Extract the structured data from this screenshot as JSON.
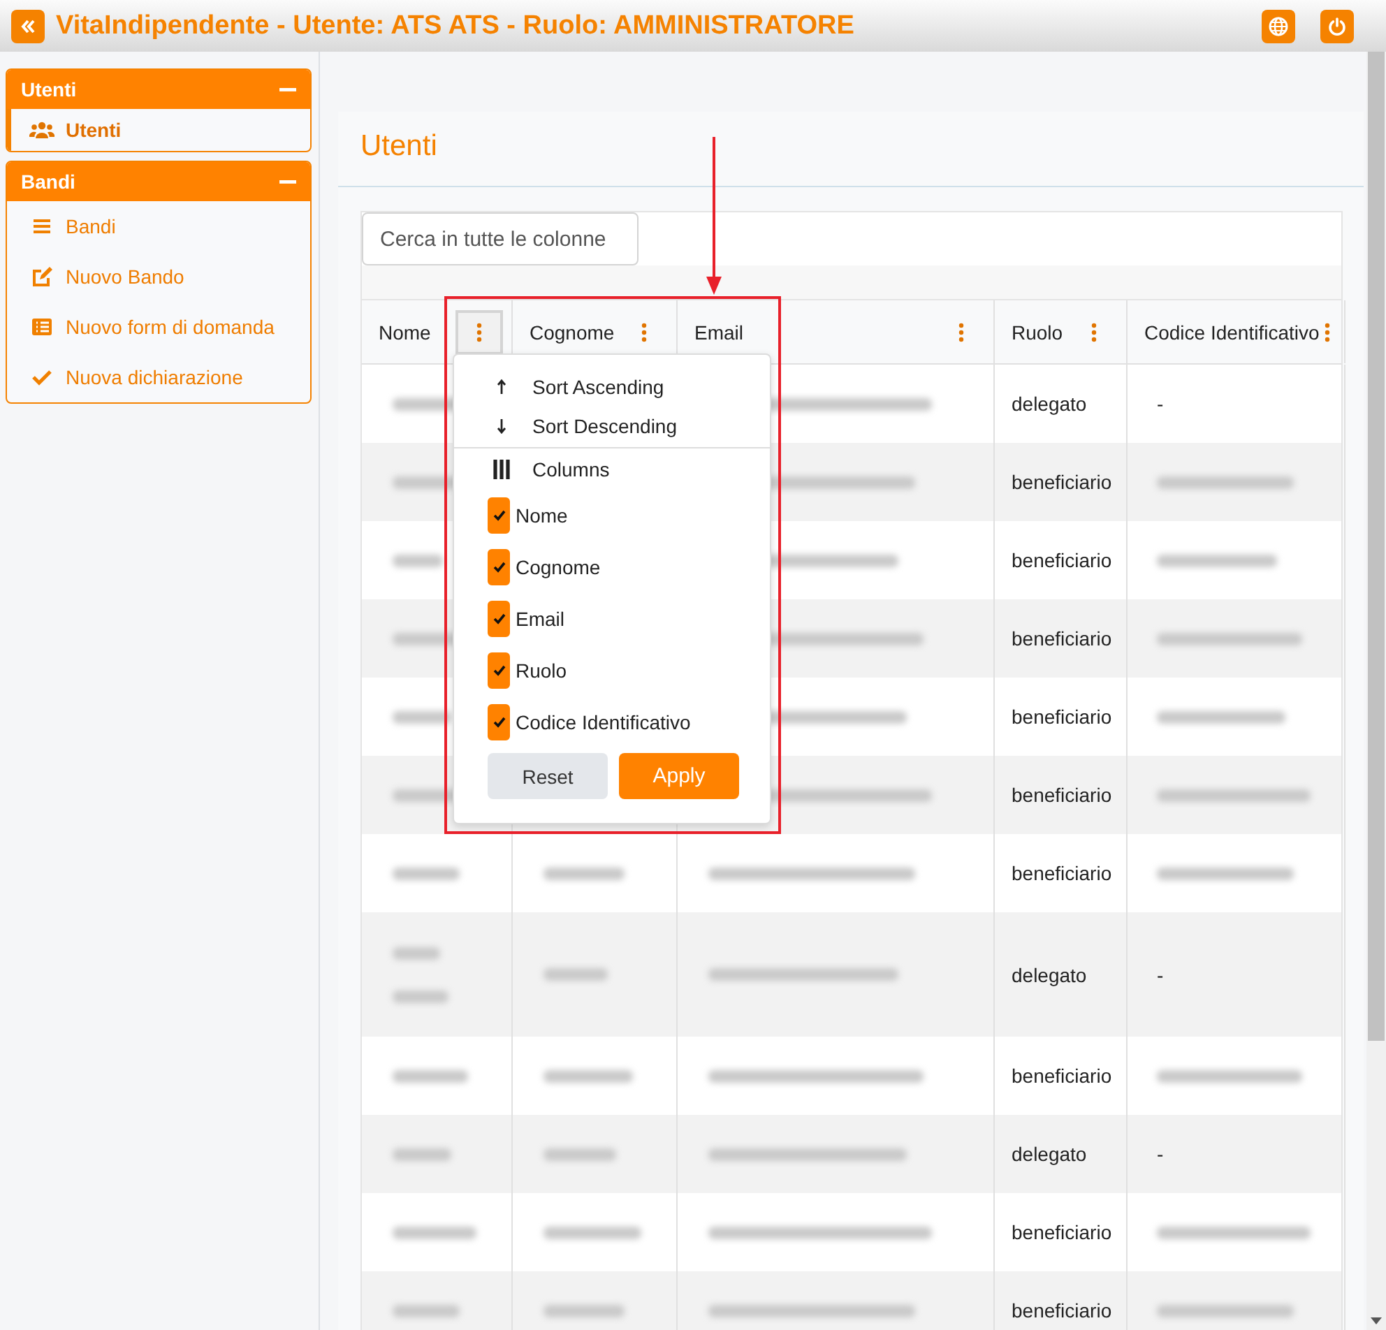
{
  "header": {
    "title": "VitaIndipendente - Utente: ATS ATS - Ruolo: AMMINISTRATORE"
  },
  "sidebar": {
    "groups": [
      {
        "title": "Utenti",
        "expanded": true,
        "items": [
          {
            "label": "Utenti",
            "kind": "users",
            "selected": true
          }
        ]
      },
      {
        "title": "Bandi",
        "expanded": true,
        "items": [
          {
            "label": "Bandi",
            "kind": "list",
            "selected": false
          },
          {
            "label": "Nuovo Bando",
            "kind": "edit",
            "selected": false
          },
          {
            "label": "Nuovo form di domanda",
            "kind": "form",
            "selected": false
          },
          {
            "label": "Nuova dichiarazione",
            "kind": "check",
            "selected": false
          }
        ]
      }
    ]
  },
  "page": {
    "title": "Utenti"
  },
  "search": {
    "placeholder": "Cerca in tutte le colonne"
  },
  "table": {
    "columns": [
      {
        "label": "Nome",
        "menu_open": true
      },
      {
        "label": "Cognome",
        "menu_open": false
      },
      {
        "label": "Email",
        "menu_open": false
      },
      {
        "label": "Ruolo",
        "menu_open": false
      },
      {
        "label": "Codice Identificativo",
        "menu_open": false
      }
    ],
    "rows": [
      {
        "cells": [
          {
            "kind": "blurred"
          },
          null,
          {
            "kind": "blurred"
          },
          {
            "kind": "text",
            "text": "delegato"
          },
          {
            "kind": "text",
            "text": "-"
          }
        ]
      },
      {
        "cells": [
          {
            "kind": "blurred"
          },
          null,
          {
            "kind": "blurred"
          },
          {
            "kind": "text",
            "text": "beneficiario"
          },
          {
            "kind": "blurred"
          }
        ]
      },
      {
        "cells": [
          {
            "kind": "blurred"
          },
          null,
          {
            "kind": "blurred"
          },
          {
            "kind": "text",
            "text": "beneficiario"
          },
          {
            "kind": "blurred"
          }
        ]
      },
      {
        "cells": [
          {
            "kind": "blurred"
          },
          null,
          {
            "kind": "blurred"
          },
          {
            "kind": "text",
            "text": "beneficiario"
          },
          {
            "kind": "blurred"
          }
        ]
      },
      {
        "cells": [
          {
            "kind": "blurred"
          },
          null,
          {
            "kind": "blurred"
          },
          {
            "kind": "text",
            "text": "beneficiario"
          },
          {
            "kind": "blurred"
          }
        ]
      },
      {
        "cells": [
          {
            "kind": "blurred"
          },
          null,
          {
            "kind": "blurred"
          },
          {
            "kind": "text",
            "text": "beneficiario"
          },
          {
            "kind": "blurred"
          }
        ]
      },
      {
        "cells": [
          {
            "kind": "blurred"
          },
          {
            "kind": "blurred"
          },
          {
            "kind": "blurred"
          },
          {
            "kind": "text",
            "text": "beneficiario"
          },
          {
            "kind": "blurred"
          }
        ]
      },
      {
        "cells": [
          {
            "kind": "blurred_tall"
          },
          {
            "kind": "blurred"
          },
          {
            "kind": "blurred"
          },
          {
            "kind": "text",
            "text": "delegato"
          },
          {
            "kind": "text",
            "text": "-"
          }
        ]
      },
      {
        "cells": [
          {
            "kind": "blurred"
          },
          {
            "kind": "blurred"
          },
          {
            "kind": "blurred"
          },
          {
            "kind": "text",
            "text": "beneficiario"
          },
          {
            "kind": "blurred"
          }
        ]
      },
      {
        "cells": [
          {
            "kind": "blurred"
          },
          {
            "kind": "blurred"
          },
          {
            "kind": "blurred"
          },
          {
            "kind": "text",
            "text": "delegato"
          },
          {
            "kind": "text",
            "text": "-"
          }
        ]
      },
      {
        "cells": [
          {
            "kind": "blurred"
          },
          {
            "kind": "blurred"
          },
          {
            "kind": "blurred"
          },
          {
            "kind": "text",
            "text": "beneficiario"
          },
          {
            "kind": "blurred"
          }
        ]
      },
      {
        "cells": [
          {
            "kind": "blurred"
          },
          {
            "kind": "blurred"
          },
          {
            "kind": "blurred"
          },
          {
            "kind": "text",
            "text": "beneficiario"
          },
          {
            "kind": "blurred"
          }
        ]
      }
    ]
  },
  "column_menu": {
    "sort": [
      {
        "label": "Sort Ascending",
        "kind": "asc"
      },
      {
        "label": "Sort Descending",
        "kind": "desc"
      }
    ],
    "columns_label": "Columns",
    "options": [
      {
        "label": "Nome",
        "checked": true
      },
      {
        "label": "Cognome",
        "checked": true
      },
      {
        "label": "Email",
        "checked": true
      },
      {
        "label": "Ruolo",
        "checked": true
      },
      {
        "label": "Codice Identificativo",
        "checked": true
      }
    ],
    "buttons": [
      {
        "label": "Reset",
        "kind": "secondary"
      },
      {
        "label": "Apply",
        "kind": "primary"
      }
    ]
  },
  "annotation": {
    "frame": true,
    "arrow": true
  }
}
